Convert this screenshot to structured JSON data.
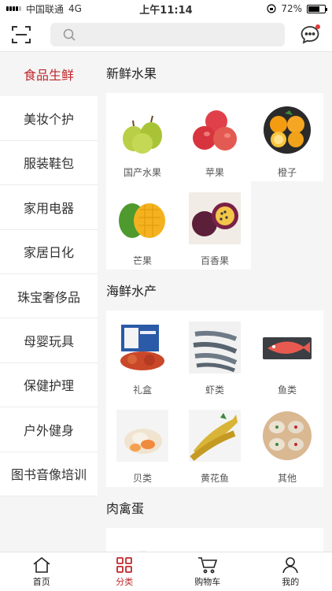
{
  "status": {
    "carrier": "中国联通",
    "network": "4G",
    "time": "上午11:14",
    "battery": "72%",
    "battery_level": 0.72
  },
  "search": {
    "placeholder": ""
  },
  "sidebar": {
    "items": [
      {
        "label": "食品生鲜",
        "active": true
      },
      {
        "label": "美妆个护"
      },
      {
        "label": "服装鞋包"
      },
      {
        "label": "家用电器"
      },
      {
        "label": "家居日化"
      },
      {
        "label": "珠宝奢侈品"
      },
      {
        "label": "母婴玩具"
      },
      {
        "label": "保健护理"
      },
      {
        "label": "户外健身"
      },
      {
        "label": "图书音像培训"
      }
    ]
  },
  "sections": [
    {
      "title": "新鲜水果",
      "items": [
        {
          "label": "国产水果",
          "icon": "pear"
        },
        {
          "label": "苹果",
          "icon": "apple"
        },
        {
          "label": "橙子",
          "icon": "orange"
        },
        {
          "label": "芒果",
          "icon": "mango"
        },
        {
          "label": "百香果",
          "icon": "passionfruit"
        }
      ]
    },
    {
      "title": "海鲜水产",
      "items": [
        {
          "label": "礼盒",
          "icon": "gift-box"
        },
        {
          "label": "虾类",
          "icon": "shrimp"
        },
        {
          "label": "鱼类",
          "icon": "fish"
        },
        {
          "label": "贝类",
          "icon": "scallop"
        },
        {
          "label": "黄花鱼",
          "icon": "yellow-croaker"
        },
        {
          "label": "其他",
          "icon": "oysters"
        }
      ]
    },
    {
      "title": "肉禽蛋",
      "items": [
        {
          "label": "",
          "icon": "plate"
        },
        {
          "label": "",
          "icon": "blank"
        },
        {
          "label": "",
          "icon": "bowl"
        }
      ]
    }
  ],
  "tabbar": {
    "home": "首页",
    "category": "分类",
    "cart": "购物车",
    "mine": "我的"
  },
  "colors": {
    "accent": "#c0272d"
  }
}
